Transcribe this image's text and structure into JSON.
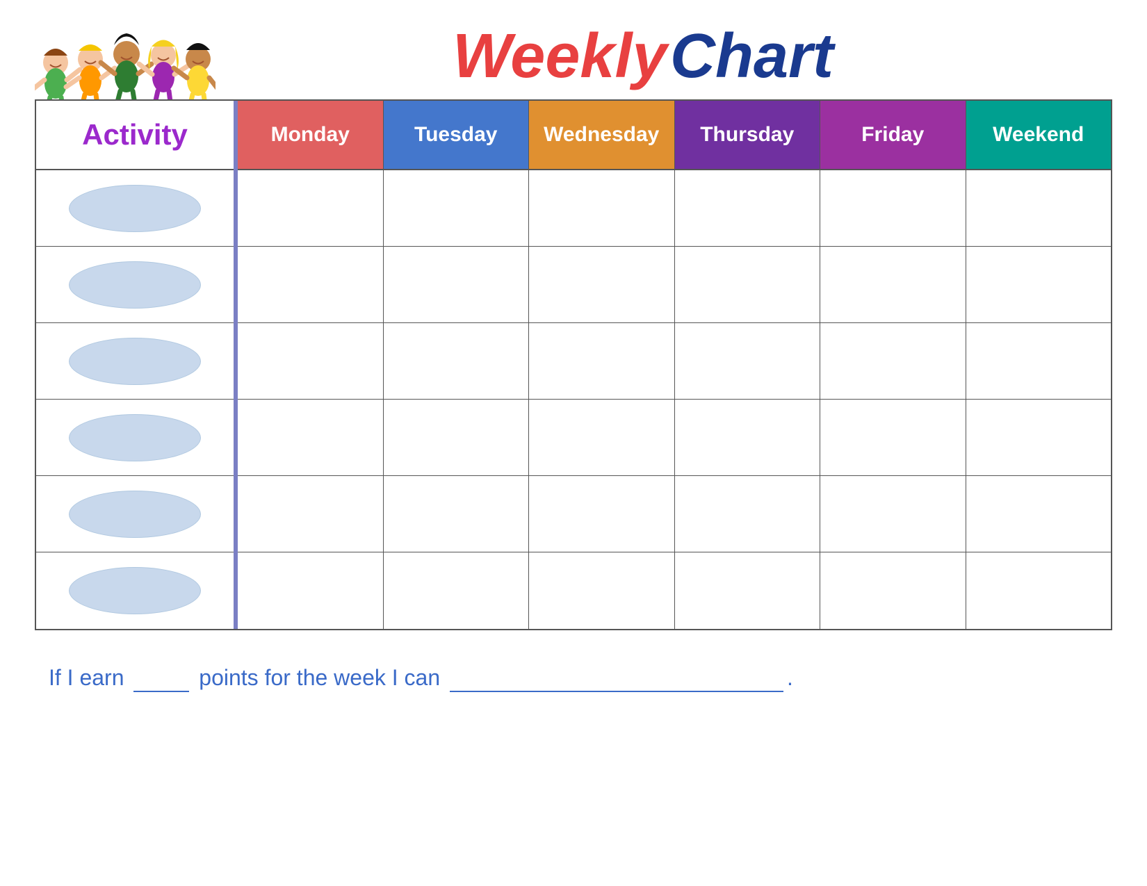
{
  "title": {
    "weekly": "Weekly",
    "chart": "Chart"
  },
  "activity_label": "Activity",
  "days": [
    {
      "key": "monday",
      "label": "Monday",
      "color": "#e06060"
    },
    {
      "key": "tuesday",
      "label": "Tuesday",
      "color": "#4477cc"
    },
    {
      "key": "wednesday",
      "label": "Wednesday",
      "color": "#e09030"
    },
    {
      "key": "thursday",
      "label": "Thursday",
      "color": "#7030a0"
    },
    {
      "key": "friday",
      "label": "Friday",
      "color": "#9b30a0"
    },
    {
      "key": "weekend",
      "label": "Weekend",
      "color": "#00a090"
    }
  ],
  "rows": 6,
  "bottom_text": {
    "prefix": "If I earn",
    "middle": "points for the week I can",
    "suffix": "."
  }
}
